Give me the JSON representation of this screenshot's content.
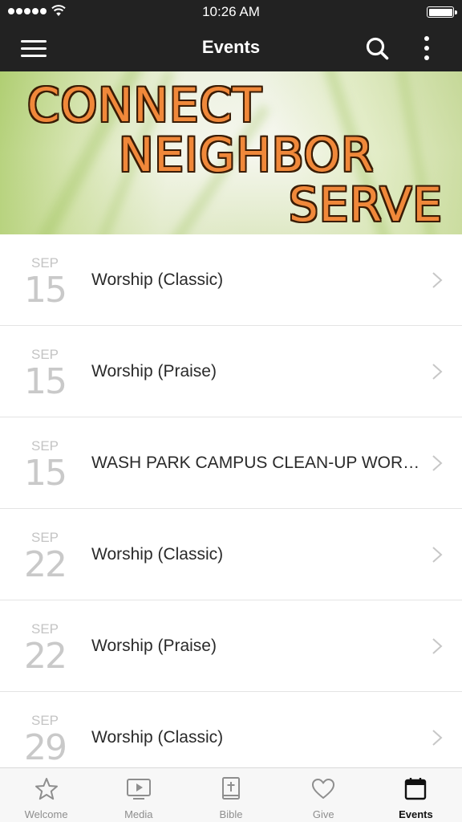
{
  "status_bar": {
    "time": "10:26 AM"
  },
  "nav": {
    "title": "Events"
  },
  "banner": {
    "line1": "CONNECT",
    "line2": "NEIGHBOR",
    "line3": "SERVE"
  },
  "events": [
    {
      "month": "SEP",
      "day": "15",
      "title": "Worship (Classic)"
    },
    {
      "month": "SEP",
      "day": "15",
      "title": "Worship (Praise)"
    },
    {
      "month": "SEP",
      "day": "15",
      "title": "WASH PARK CAMPUS CLEAN-UP WORK DAY"
    },
    {
      "month": "SEP",
      "day": "22",
      "title": "Worship (Classic)"
    },
    {
      "month": "SEP",
      "day": "22",
      "title": "Worship (Praise)"
    },
    {
      "month": "SEP",
      "day": "29",
      "title": "Worship (Classic)"
    }
  ],
  "tabs": [
    {
      "label": "Welcome",
      "icon": "star-icon"
    },
    {
      "label": "Media",
      "icon": "play-icon"
    },
    {
      "label": "Bible",
      "icon": "bible-icon"
    },
    {
      "label": "Give",
      "icon": "heart-icon"
    },
    {
      "label": "Events",
      "icon": "calendar-icon",
      "active": true
    }
  ],
  "colors": {
    "bar": "#222222",
    "accent": "#f0883a",
    "muted": "#c4c4c4"
  }
}
